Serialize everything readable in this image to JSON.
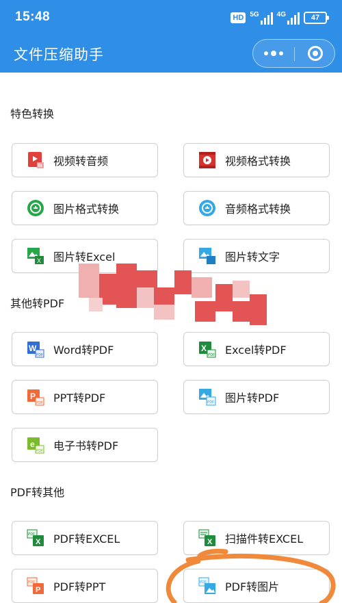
{
  "status_bar": {
    "time": "15:48",
    "hd": "HD",
    "network_1": "5G",
    "network_2": "4G",
    "battery": "47"
  },
  "header": {
    "title": "文件压缩助手"
  },
  "sections": {
    "special": "特色转换",
    "other_to_pdf": "其他转PDF",
    "pdf_to_other": "PDF转其他"
  },
  "buttons": {
    "video_to_audio": "视频转音频",
    "video_format": "视频格式转换",
    "image_format": "图片格式转换",
    "audio_format": "音频格式转换",
    "image_to_excel": "图片转Excel",
    "image_to_text": "图片转文字",
    "word_to_pdf": "Word转PDF",
    "excel_to_pdf": "Excel转PDF",
    "ppt_to_pdf": "PPT转PDF",
    "image_to_pdf": "图片转PDF",
    "ebook_to_pdf": "电子书转PDF",
    "pdf_to_excel": "PDF转EXCEL",
    "scan_to_excel": "扫描件转EXCEL",
    "pdf_to_ppt": "PDF转PPT",
    "pdf_to_image": "PDF转图片"
  },
  "colors": {
    "header_blue": "#2f8ee6",
    "icon_red": "#e0413c",
    "icon_green": "#27a74a",
    "icon_blue": "#2f8ee6",
    "icon_cyan": "#35a9e6",
    "icon_orange": "#f06a3a",
    "annotation_orange": "#f08a3a",
    "redaction_red": "#e35454"
  }
}
